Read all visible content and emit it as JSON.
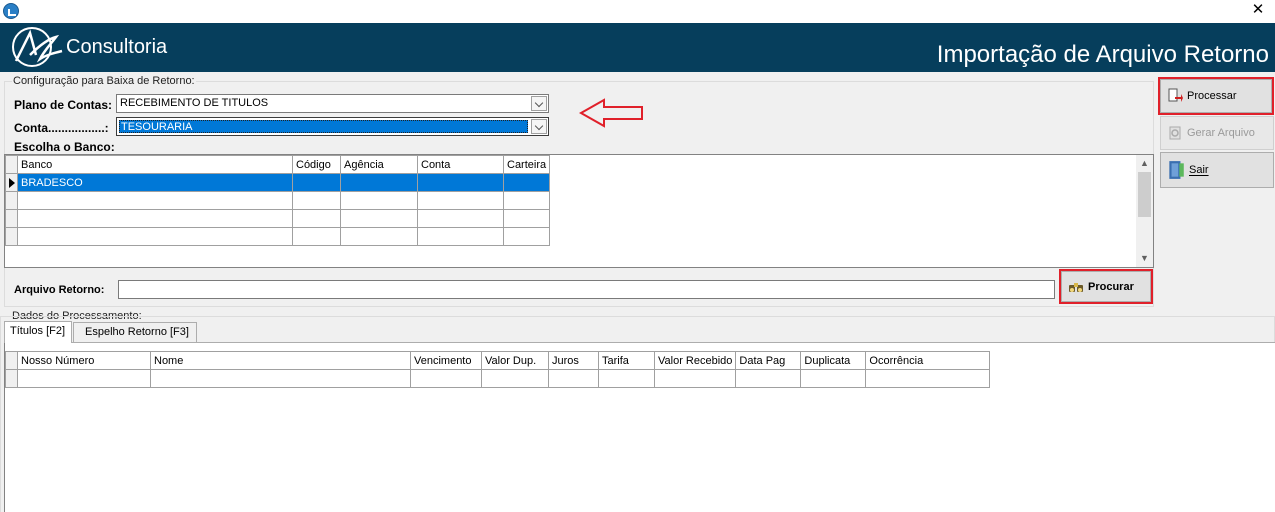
{
  "window": {
    "close_glyph": "✕"
  },
  "header": {
    "logo_text": "Consultoria",
    "title": "Importação de Arquivo Retorno"
  },
  "config": {
    "group_label": "Configuração para Baixa de Retorno:",
    "plano_label": "Plano de Contas:",
    "plano_value": "RECEBIMENTO DE TITULOS",
    "conta_label": "Conta.................:",
    "conta_value": "TESOURARIA",
    "banco_label": "Escolha o Banco:"
  },
  "bank_grid": {
    "headers": [
      "Banco",
      "Código",
      "Agência",
      "Conta",
      "Carteira"
    ],
    "rows": [
      [
        "BRADESCO",
        "",
        "",
        "",
        ""
      ],
      [
        "",
        "",
        "",
        "",
        ""
      ],
      [
        "",
        "",
        "",
        "",
        ""
      ],
      [
        "",
        "",
        "",
        "",
        ""
      ]
    ]
  },
  "arquivo": {
    "label": "Arquivo Retorno:",
    "value": "",
    "browse_label": "Procurar"
  },
  "side_buttons": {
    "processar": "Processar",
    "gerar": "Gerar Arquivo",
    "sair": "Sair"
  },
  "dados": {
    "group_label": "Dados do Processamento:",
    "tabs": [
      "Títulos [F2]",
      "Espelho Retorno [F3]"
    ],
    "headers": [
      "Nosso Número",
      "Nome",
      "Vencimento",
      "Valor Dup.",
      "Juros",
      "Tarifa",
      "Valor Recebido",
      "Data Pag",
      "Duplicata",
      "Ocorrência"
    ]
  },
  "colors": {
    "banner": "#063e5c",
    "selection": "#0078d7",
    "highlight": "#e0202a"
  }
}
